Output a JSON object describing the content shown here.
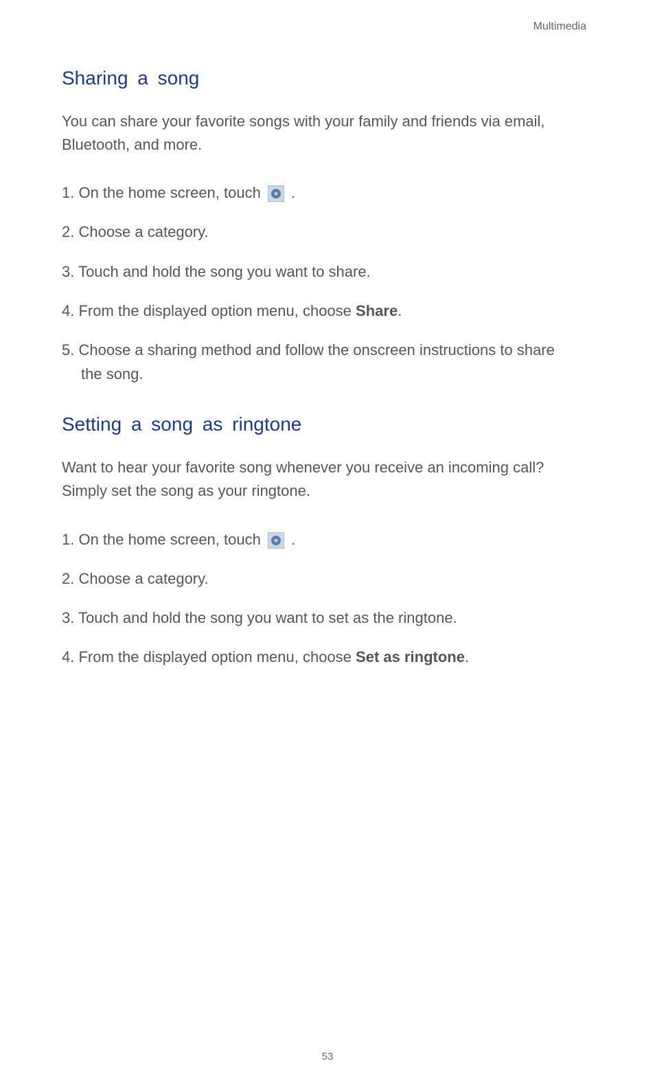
{
  "header": {
    "category": "Multimedia"
  },
  "section1": {
    "heading": "Sharing a song",
    "intro": "You can share your favorite songs with your family and friends via email, Bluetooth, and more.",
    "steps": {
      "s1_pre": "1. On the home screen, touch ",
      "s1_post": " .",
      "s2": "2. Choose a category.",
      "s3": "3. Touch and hold the song you want to share.",
      "s4_pre": "4. From the displayed option menu, choose ",
      "s4_bold": "Share",
      "s4_post": ".",
      "s5_line1": "5. Choose a sharing method and follow the onscreen instructions to share",
      "s5_line2": "the song."
    }
  },
  "section2": {
    "heading": "Setting a song as ringtone",
    "intro": "Want to hear your favorite song whenever you receive an incoming call? Simply set the song as your ringtone.",
    "steps": {
      "s1_pre": "1. On the home screen, touch ",
      "s1_post": " .",
      "s2": "2. Choose a category.",
      "s3": "3. Touch and hold the song you want to set as the ringtone.",
      "s4_pre": "4. From the displayed option menu, choose ",
      "s4_bold": "Set as ringtone",
      "s4_post": "."
    }
  },
  "footer": {
    "page_number": "53"
  },
  "icons": {
    "music_app": "music-icon"
  }
}
